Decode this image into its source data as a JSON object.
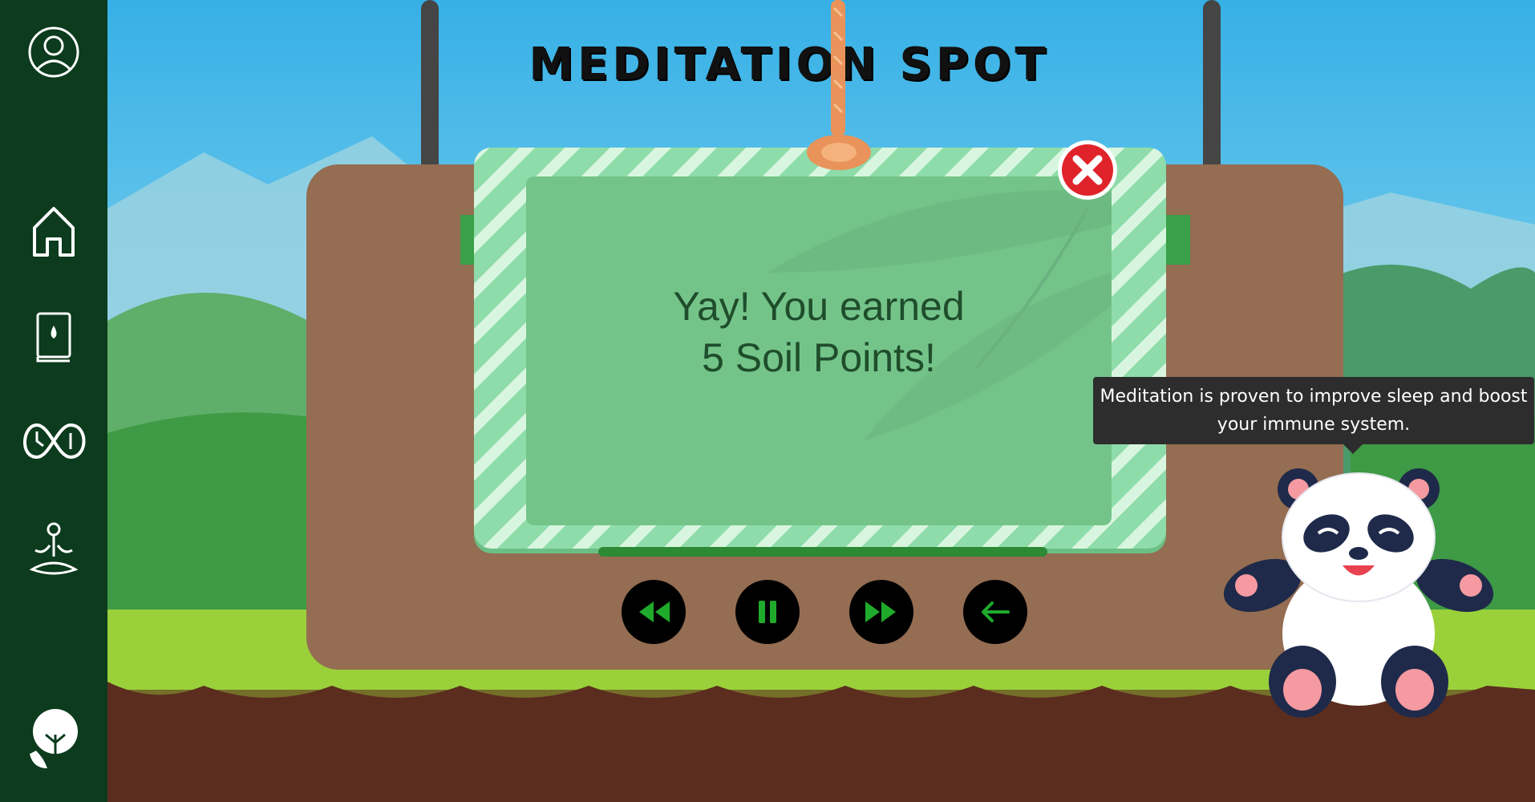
{
  "sidebar": {
    "items": [
      {
        "icon": "user-icon"
      },
      {
        "icon": "home-icon"
      },
      {
        "icon": "journal-icon"
      },
      {
        "icon": "infinity-clock-icon"
      },
      {
        "icon": "meditation-icon"
      },
      {
        "icon": "tree-head-logo-icon"
      }
    ]
  },
  "header": {
    "title": "MEDITATION SPOT"
  },
  "card": {
    "message_line1": "Yay! You earned",
    "message_line2": "5 Soil Points!",
    "close_icon": "close-icon"
  },
  "controls": [
    {
      "icon": "rewind-icon"
    },
    {
      "icon": "pause-icon"
    },
    {
      "icon": "fast-forward-icon"
    },
    {
      "icon": "back-arrow-icon"
    }
  ],
  "tooltip": {
    "text": "Meditation is proven to improve sleep and boost your immune system."
  },
  "colors": {
    "sidebar": "#0c3b1e",
    "sky": "#3db3e3",
    "board": "#946d52",
    "card": "#74c48a",
    "control_icon": "#1faa2c",
    "close_button": "#e0232b"
  }
}
